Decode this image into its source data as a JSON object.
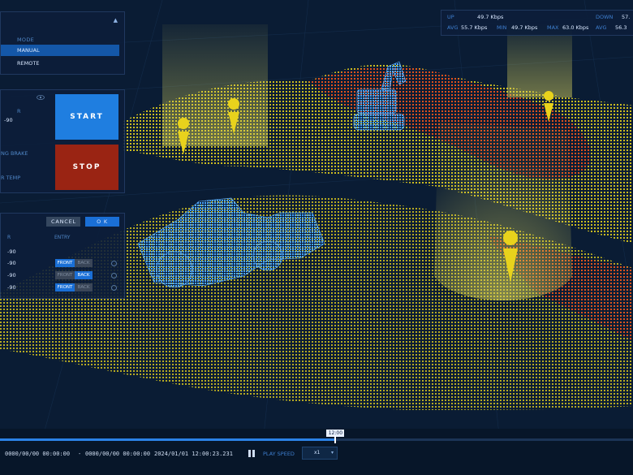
{
  "mode": {
    "title": "MODE",
    "options": [
      "MANUAL",
      "REMOTE"
    ],
    "selected": "MANUAL"
  },
  "control": {
    "label_partial_a": "R",
    "value_partial": "-90",
    "label_brake": "NG BRAKE",
    "label_temp": "R TEMP",
    "start_label": "START",
    "stop_label": "STOP"
  },
  "table": {
    "cancel_label": "CANCEL",
    "ok_label": "O K",
    "col_a": "R",
    "col_b": "ENTRY",
    "rows": [
      {
        "value": "-90",
        "toggle": null
      },
      {
        "value": "-90",
        "toggle": "FRONT"
      },
      {
        "value": "-90",
        "toggle": "BACK"
      },
      {
        "value": "-90",
        "toggle": "FRONT"
      }
    ],
    "front_label": "FRONT",
    "back_label": "BACK"
  },
  "stats": {
    "up_label": "UP",
    "up_value": "49.7 Kbps",
    "down_label": "DOWN",
    "down_value": "57.",
    "avg_label": "AVG",
    "avg_value": "55.7 Kbps",
    "min_label": "MIN",
    "min_value": "49.7 Kbps",
    "max_label": "MAX",
    "max_value": "63.0 Kbps",
    "avg2_label": "AVG",
    "avg2_value": "56.3"
  },
  "timeline": {
    "playhead_time": "12:00",
    "start_time": "0000/00/00 00:00:00",
    "end_time": "0000/00/00 00:00:00",
    "current_time": "2024/01/01 12:00:23.231",
    "play_speed_label": "PLAY SPEED",
    "speed_value": "x1",
    "progress": 0.53
  },
  "colors": {
    "accent": "#1f7ee0",
    "stop": "#9a2413",
    "terrain_low": "#d9c51a",
    "terrain_high": "#d8361a",
    "machine": "#3d9cf0",
    "marker": "#e8d21c"
  },
  "icons": [
    "eye-icon",
    "collapse-arrow-icon",
    "pause-icon",
    "chevron-down-icon",
    "location-marker-icon"
  ]
}
